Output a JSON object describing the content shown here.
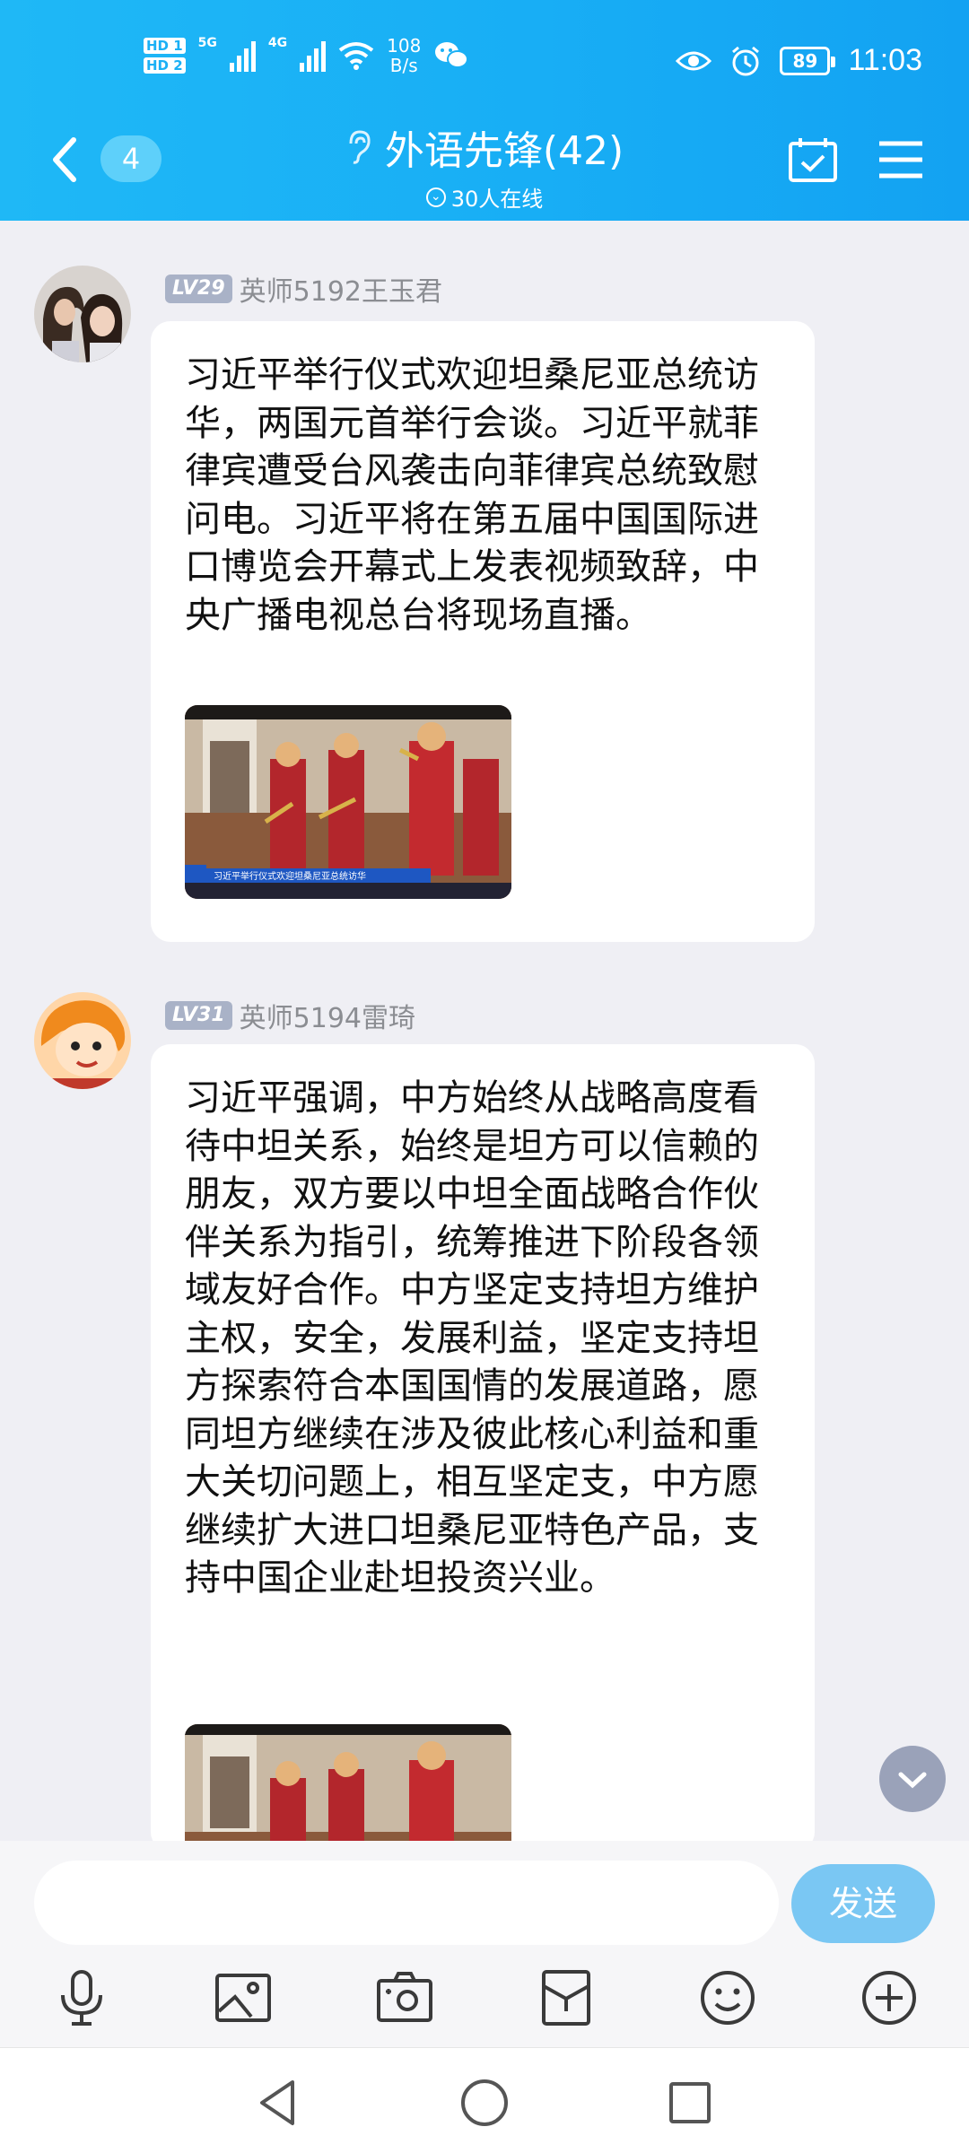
{
  "status_bar": {
    "hd1": "HD 1",
    "hd2": "HD 2",
    "net1": "5G",
    "net2": "4G",
    "speed_value": "108",
    "speed_unit": "B/s",
    "battery": "89",
    "time": "11:03"
  },
  "navbar": {
    "unread_badge": "4",
    "title": "外语先锋(42)",
    "online": "30人在线"
  },
  "messages": [
    {
      "level": "LV29",
      "sender": "英师5192王玉君",
      "text": "习近平举行仪式欢迎坦桑尼亚总统访华，两国元首举行会谈。习近平就菲律宾遭受台风袭击向菲律宾总统致慰问电。习近平将在第五届中国国际进口博览会开幕式上发表视频致辞，中央广播电视总台将现场直播。",
      "image_caption": "习近平举行仪式欢迎坦桑尼亚总统访华"
    },
    {
      "level": "LV31",
      "sender": "英师5194雷琦",
      "text": "习近平强调，中方始终从战略高度看待中坦关系，始终是坦方可以信赖的朋友，双方要以中坦全面战略合作伙伴关系为指引，统筹推进下阶段各领域友好合作。中方坚定支持坦方维护主权，安全，发展利益，坚定支持坦方探索符合本国国情的发展道路，愿同坦方继续在涉及彼此核心利益和重大关切问题上，相互坚定支，中方愿继续扩大进口坦桑尼亚特色产品，支持中国企业赴坦投资兴业。"
    }
  ],
  "input": {
    "placeholder": "",
    "send_label": "发送"
  },
  "toolbar_icons": [
    "microphone-icon",
    "picture-icon",
    "camera-icon",
    "red-packet-icon",
    "emoji-icon",
    "plus-icon"
  ],
  "system_nav": [
    "back-triangle-icon",
    "home-circle-icon",
    "recents-square-icon"
  ],
  "colors": {
    "header": "#1bb0f5",
    "send_button": "#7ac7f3",
    "background": "#efeff4"
  }
}
